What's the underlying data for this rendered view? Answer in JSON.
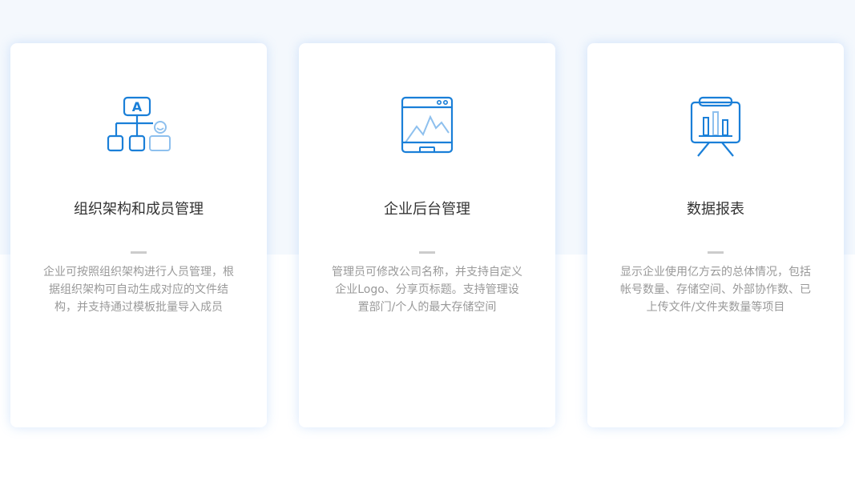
{
  "features": [
    {
      "icon": "org-chart-icon",
      "title": "组织架构和成员管理",
      "desc_lines": [
        "企业可按照组织架构进行人员管理，根",
        "据组织架构可自动生成对应的文件结",
        "构，并支持通过模板批量导入成员"
      ],
      "icon_letter": "A"
    },
    {
      "icon": "admin-dashboard-icon",
      "title": "企业后台管理",
      "desc_lines": [
        "管理员可修改公司名称，并支持自定义",
        "企业Logo、分享页标题。支持管理设",
        "置部门/个人的最大存储空间"
      ]
    },
    {
      "icon": "presentation-chart-icon",
      "title": "数据报表",
      "desc_lines": [
        "显示企业使用亿方云的总体情况，包括",
        "帐号数量、存储空间、外部协作数、已",
        "上传文件/文件夹数量等项目"
      ]
    }
  ],
  "colors": {
    "icon_blue": "#1a7fd8",
    "icon_light_blue": "#8ec0ee",
    "title_text": "#333333",
    "desc_text": "#999999",
    "divider": "#cccccc",
    "band_bg": "#f4f8fd"
  }
}
